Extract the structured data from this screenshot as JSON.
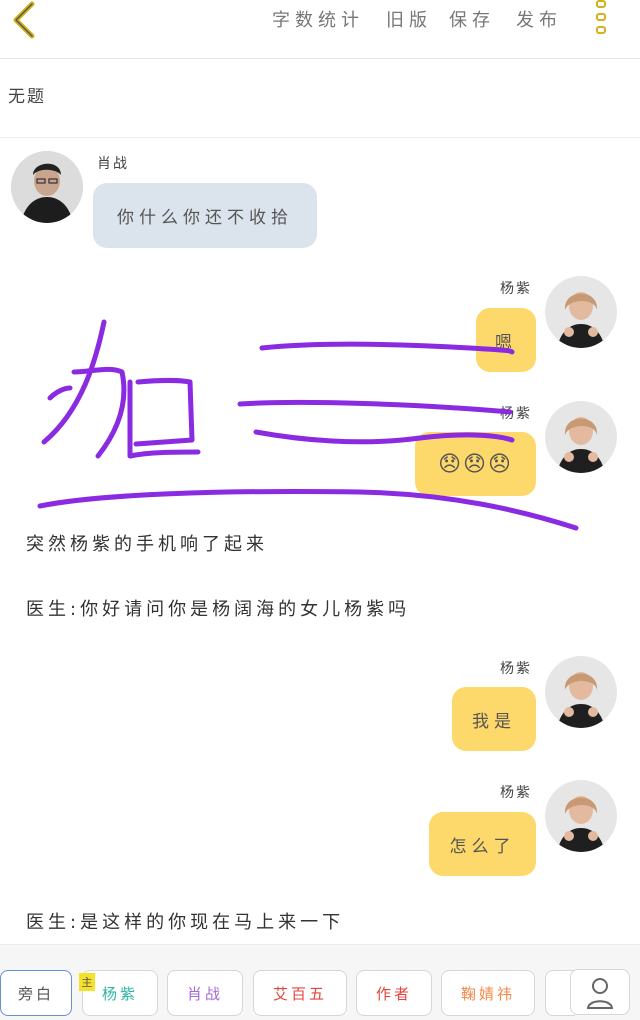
{
  "header": {
    "word_count": "字数统计",
    "old_version": "旧版",
    "save": "保存",
    "publish": "发布"
  },
  "doc": {
    "title": "无题"
  },
  "messages": [
    {
      "speaker": "肖战",
      "text": "你什么你还不收拾",
      "side": "left"
    },
    {
      "speaker": "杨紫",
      "text": "嗯",
      "side": "right"
    },
    {
      "speaker": "杨紫",
      "text": "😞😞😞",
      "side": "right"
    },
    {
      "speaker": "杨紫",
      "text": "我是",
      "side": "right"
    },
    {
      "speaker": "杨紫",
      "text": "怎么了",
      "side": "right"
    }
  ],
  "narrations": [
    "突然杨紫的手机响了起来",
    "医生:你好请问你是杨阔海的女儿杨紫吗",
    "医生:是这样的你现在马上来一下"
  ],
  "overlay": {
    "handwriting": "加三"
  },
  "characters": {
    "host_tag": "主",
    "chips": [
      {
        "label": "旁白",
        "color": "#555555"
      },
      {
        "label": "杨紫",
        "color": "#2fb3a3"
      },
      {
        "label": "肖战",
        "color": "#a56bd6"
      },
      {
        "label": "艾百五",
        "color": "#e0463c"
      },
      {
        "label": "作者",
        "color": "#e0463c"
      },
      {
        "label": "鞠婧祎",
        "color": "#f08a4a"
      }
    ]
  },
  "colors": {
    "accent_yellow": "#fdd86a",
    "bubble_left": "#dbe4ec",
    "scribble_purple": "#8a2be2",
    "back_arrow": "#d6b21a"
  }
}
